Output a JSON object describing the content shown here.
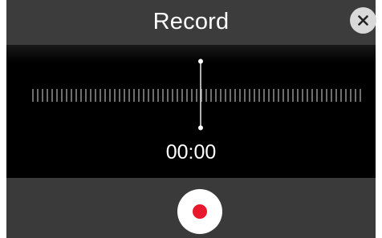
{
  "header": {
    "title": "Record",
    "close_icon": "close-icon"
  },
  "waveform": {
    "icon": "waveform-ticks",
    "playhead_icon": "playhead-marker"
  },
  "timer": {
    "value": "00:00"
  },
  "controls": {
    "record_icon": "record-icon",
    "record_color": "#e8192c"
  },
  "colors": {
    "header_bg": "#3c3c3c",
    "stage_bg": "#000000",
    "close_button_bg": "#d9d9d9"
  }
}
